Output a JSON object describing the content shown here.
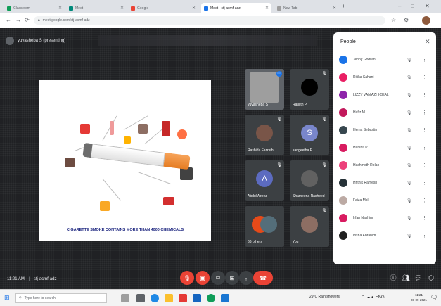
{
  "browser": {
    "tabs": [
      {
        "label": "Classroom",
        "active": false
      },
      {
        "label": "Meet",
        "active": false
      },
      {
        "label": "Google",
        "active": false
      },
      {
        "label": "Meet - stj-acmf-adz",
        "active": true
      },
      {
        "label": "New Tab",
        "active": false
      }
    ],
    "address": "meet.google.com/stj-acmf-adz"
  },
  "meet": {
    "presenting_label": "yuvasheba S (presenting)",
    "slide_caption": "CIGARETTE SMOKE CONTAINS MORE THAN 4000 CHEMICALS",
    "meeting_time": "11:21 AM",
    "meeting_code": "stj-acmf-adz",
    "tiles": [
      {
        "name": "yuvasheba S",
        "initial": ""
      },
      {
        "name": "Ranjith P",
        "initial": ""
      },
      {
        "name": "Rashida Farzath",
        "initial": ""
      },
      {
        "name": "sangeetha P",
        "initial": "S"
      },
      {
        "name": "Abdul Azeez",
        "initial": "A"
      },
      {
        "name": "Shameena Rasheed",
        "initial": ""
      },
      {
        "name": "66 others",
        "initial": ""
      },
      {
        "name": "You",
        "initial": ""
      }
    ]
  },
  "people_panel": {
    "title": "People",
    "participants": [
      "Jenny Godwin",
      "Ritika Sahani",
      "LIZZY VAN AZHICHAL",
      "Hafiz M",
      "Hema Sebastin",
      "Harshit P",
      "Hashmeth Rolan",
      "Hrithik Ramesh",
      "Faiza Mol",
      "Irfan Nashim",
      "Insha Ebrahim"
    ]
  },
  "taskbar": {
    "search_placeholder": "Type here to search",
    "tray_text": "29°C Rain showers",
    "time": "11:21",
    "date": "28-09-2021"
  },
  "colors": {
    "meet_bg": "#202124",
    "hangup": "#ea4335",
    "accent": "#1a73e8"
  }
}
